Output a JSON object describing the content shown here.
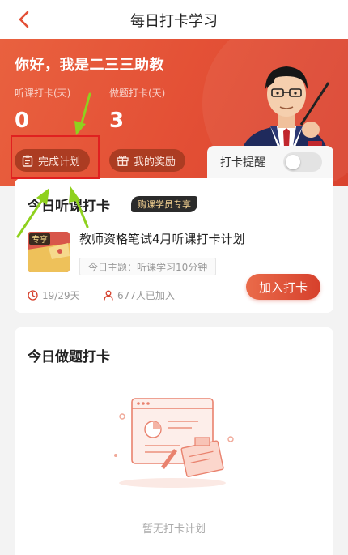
{
  "nav": {
    "title": "每日打卡学习",
    "back_icon": "chevron-left-icon"
  },
  "hero": {
    "greeting": "你好，我是二三三助教",
    "stats": [
      {
        "label": "听课打卡(天)",
        "value": "0"
      },
      {
        "label": "做题打卡(天)",
        "value": "3"
      }
    ],
    "buttons": [
      {
        "label": "完成计划",
        "icon": "clipboard-icon"
      },
      {
        "label": "我的奖励",
        "icon": "gift-icon"
      }
    ],
    "reminder_label": "打卡提醒",
    "reminder_enabled": false
  },
  "listen_card": {
    "title": "今日听课打卡",
    "badge": "购课学员专享",
    "thumb_tag": "专享",
    "plan_title": "教师资格笔试4月听课打卡计划",
    "topic": "今日主题：听课学习10分钟",
    "progress": "19/29天",
    "joined": "677人已加入",
    "join_button": "加入打卡"
  },
  "practice_card": {
    "title": "今日做题打卡",
    "empty_text": "暂无打卡计划"
  },
  "colors": {
    "brand": "#e34f35",
    "badge_text": "#f1cf8f",
    "annotation": "#8fd11e",
    "highlight": "#e02020"
  }
}
